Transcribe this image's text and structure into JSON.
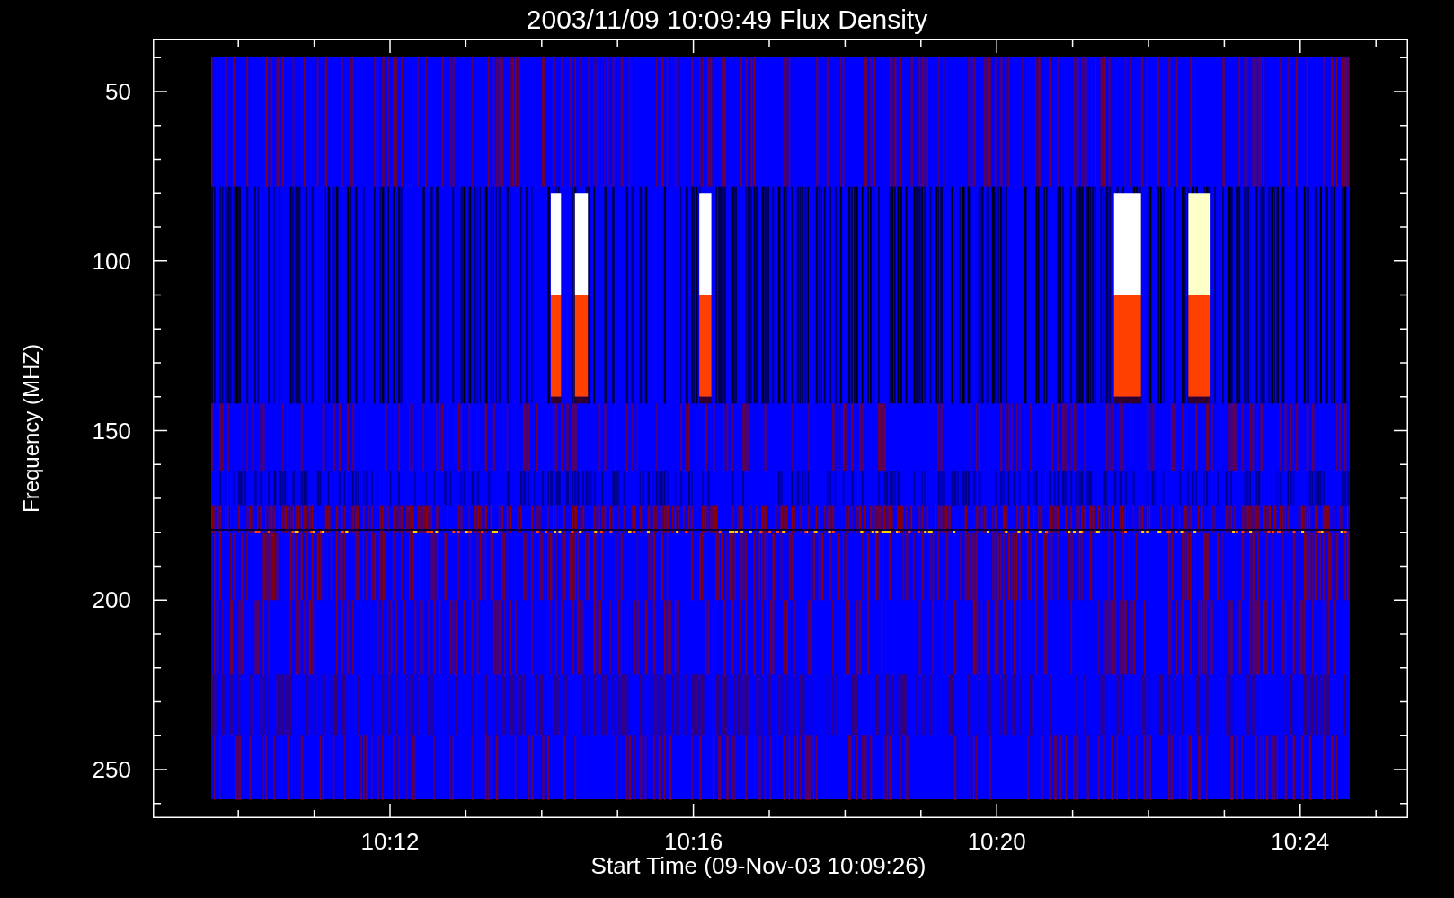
{
  "title": "2003/11/09 10:09:49 Flux Density",
  "y_axis": {
    "label": "Frequency (MHZ)",
    "ticks": [
      "50",
      "100",
      "150",
      "200",
      "250"
    ]
  },
  "x_axis": {
    "label": "Start Time (09-Nov-03 10:09:26)",
    "ticks": [
      "10:12",
      "10:16",
      "10:20",
      "10:24"
    ]
  }
}
